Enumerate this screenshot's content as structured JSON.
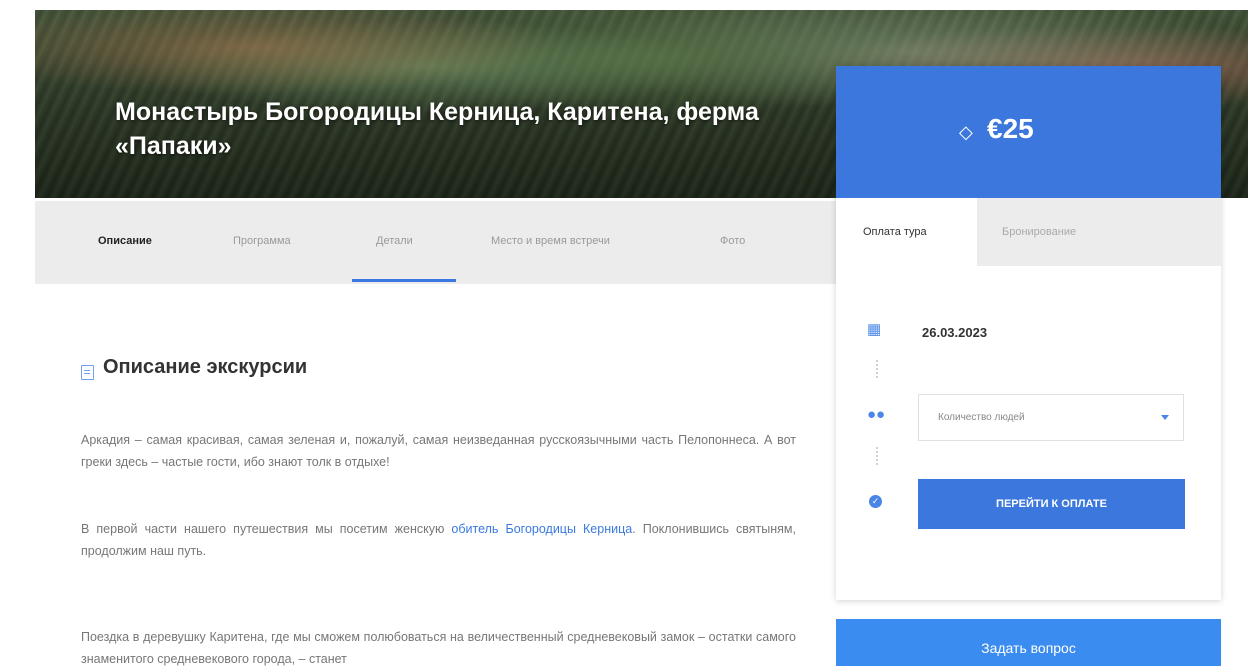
{
  "hero": {
    "title": "Монастырь Богородицы Керница, Каритена, ферма «Папаки»"
  },
  "nav_tabs": {
    "items": [
      {
        "label": "Описание",
        "active": true
      },
      {
        "label": "Программа",
        "active": false
      },
      {
        "label": "Детали",
        "active": false
      },
      {
        "label": "Место и время встречи",
        "active": false
      },
      {
        "label": "Фото",
        "active": false
      }
    ]
  },
  "section": {
    "title": "Описание экскурсии",
    "paragraphs": {
      "p1": "Аркадия – самая красивая, самая зеленая и, пожалуй, самая неизведанная русскоязычными часть Пелопоннеса. А вот греки здесь – частые гости, ибо знают толк в отдыхе!",
      "p2_before": "В первой части нашего путешествия мы посетим женскую ",
      "p2_link": "обитель Богородицы Керница",
      "p2_after": ". Поклонившись святыням, продолжим наш путь.",
      "p3": "Поездка в деревушку Каритена, где мы сможем полюбоваться на величественный средневековый замок – остатки самого знаменитого средневекового города, – станет"
    }
  },
  "booking": {
    "price": "€25",
    "tabs": {
      "payment": "Оплата тура",
      "booking": "Бронирование"
    },
    "date": "26.03.2023",
    "people_placeholder": "Количество людей",
    "pay_button": "ПЕРЕЙТИ К ОПЛАТЕ"
  },
  "ask_button": "Задать вопрос",
  "icons": {
    "doc": "document-icon",
    "tag": "price-tag-icon",
    "calendar": "calendar-icon",
    "people": "people-icon",
    "check": "check-circle-icon",
    "caret": "chevron-down-icon"
  },
  "colors": {
    "accent": "#3b77dd",
    "tab_bg": "#ececec",
    "link": "#3a7ae0"
  }
}
